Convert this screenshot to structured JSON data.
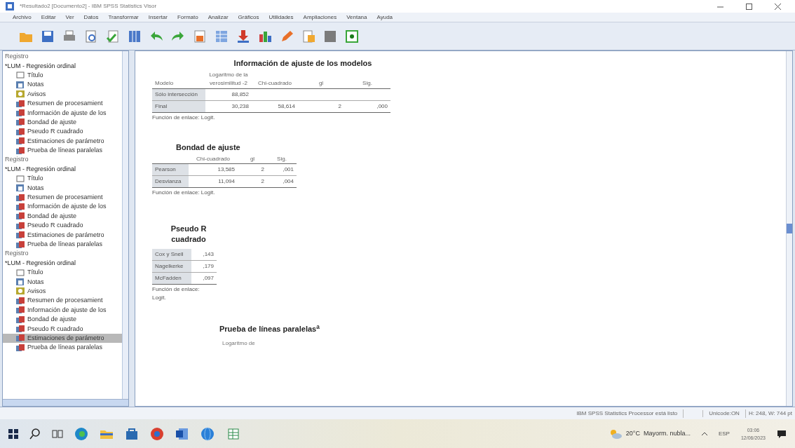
{
  "window": {
    "title": "*Resultado2 [Documento2] - IBM SPSS Statistics Visor"
  },
  "menu": [
    "Archivo",
    "Editar",
    "Ver",
    "Datos",
    "Transformar",
    "Insertar",
    "Formato",
    "Analizar",
    "Gráficos",
    "Utilidades",
    "Ampliaciones",
    "Ventana",
    "Ayuda"
  ],
  "outline": [
    {
      "label": "Registro",
      "kind": "log",
      "selected": false
    },
    {
      "label": "*LUM - Regresión ordinal",
      "kind": "procedure",
      "selected": false,
      "children": [
        {
          "label": "Título",
          "kind": "title",
          "selected": false
        },
        {
          "label": "Notas",
          "kind": "notes",
          "selected": false
        },
        {
          "label": "Avisos",
          "kind": "warnings",
          "selected": false
        },
        {
          "label": "Resumen de procesamient",
          "kind": "table",
          "selected": false
        },
        {
          "label": "Información de ajuste de los",
          "kind": "table",
          "selected": false
        },
        {
          "label": "Bondad de ajuste",
          "kind": "table",
          "selected": false
        },
        {
          "label": "Pseudo R cuadrado",
          "kind": "table",
          "selected": false
        },
        {
          "label": "Estimaciones de parámetro",
          "kind": "table",
          "selected": false
        },
        {
          "label": "Prueba de líneas paralelas",
          "kind": "table",
          "selected": false
        }
      ]
    },
    {
      "label": "Registro",
      "kind": "log",
      "selected": false
    },
    {
      "label": "*LUM - Regresión ordinal",
      "kind": "procedure",
      "selected": false,
      "children": [
        {
          "label": "Título",
          "kind": "title",
          "selected": false
        },
        {
          "label": "Notas",
          "kind": "notes",
          "selected": false
        },
        {
          "label": "Resumen de procesamient",
          "kind": "table",
          "selected": false
        },
        {
          "label": "Información de ajuste de los",
          "kind": "table",
          "selected": false
        },
        {
          "label": "Bondad de ajuste",
          "kind": "table",
          "selected": false
        },
        {
          "label": "Pseudo R cuadrado",
          "kind": "table",
          "selected": false
        },
        {
          "label": "Estimaciones de parámetro",
          "kind": "table",
          "selected": false
        },
        {
          "label": "Prueba de líneas paralelas",
          "kind": "table",
          "selected": false
        }
      ]
    },
    {
      "label": "Registro",
      "kind": "log",
      "selected": false
    },
    {
      "label": "*LUM - Regresión ordinal",
      "kind": "procedure",
      "selected": false,
      "children": [
        {
          "label": "Título",
          "kind": "title",
          "selected": false
        },
        {
          "label": "Notas",
          "kind": "notes",
          "selected": false
        },
        {
          "label": "Avisos",
          "kind": "warnings",
          "selected": false
        },
        {
          "label": "Resumen de procesamient",
          "kind": "table",
          "selected": false
        },
        {
          "label": "Información de ajuste de los",
          "kind": "table",
          "selected": false
        },
        {
          "label": "Bondad de ajuste",
          "kind": "table",
          "selected": false
        },
        {
          "label": "Pseudo R cuadrado",
          "kind": "table",
          "selected": false
        },
        {
          "label": "Estimaciones de parámetro",
          "kind": "table",
          "selected": true
        },
        {
          "label": "Prueba de líneas paralelas",
          "kind": "table",
          "selected": false
        }
      ]
    }
  ],
  "tables": [
    {
      "title": "Información de ajuste de los modelos",
      "columns": [
        "Modelo",
        "Logaritmo de la verosimilitud -2",
        "Chi-cuadrado",
        "gl",
        "Sig."
      ],
      "rows": [
        [
          "Sólo intersección",
          "88,852",
          "",
          "",
          ""
        ],
        [
          "Final",
          "30,238",
          "58,614",
          "2",
          ",000"
        ]
      ],
      "footnote": "Función de enlace: Logit."
    },
    {
      "title": "Bondad de ajuste",
      "columns": [
        "",
        "Chi-cuadrado",
        "gl",
        "Sig."
      ],
      "rows": [
        [
          "Pearson",
          "13,585",
          "2",
          ",001"
        ],
        [
          "Desvianza",
          "11,094",
          "2",
          ",004"
        ]
      ],
      "footnote": "Función de enlace: Logit."
    },
    {
      "title": "Pseudo R cuadrado",
      "rows": [
        [
          "Cox y Snell",
          ",143"
        ],
        [
          "Nagelkerke",
          ",179"
        ],
        [
          "McFadden",
          ",097"
        ]
      ],
      "footnote": "Función de enlace: Logit."
    },
    {
      "title": "Prueba de líneas paralelas$^{a}$",
      "partial_header": "Logaritmo de"
    }
  ],
  "status_bar": {
    "message": "IBM SPSS Statistics Processor está listo",
    "encoding": "Unicode:ON",
    "size": "H: 248, W: 744 pt"
  },
  "taskbar": {
    "weather": "20°C  Mayorm. nubla...",
    "language": "ESP",
    "time": "03:06",
    "date": "12/06/2023"
  }
}
